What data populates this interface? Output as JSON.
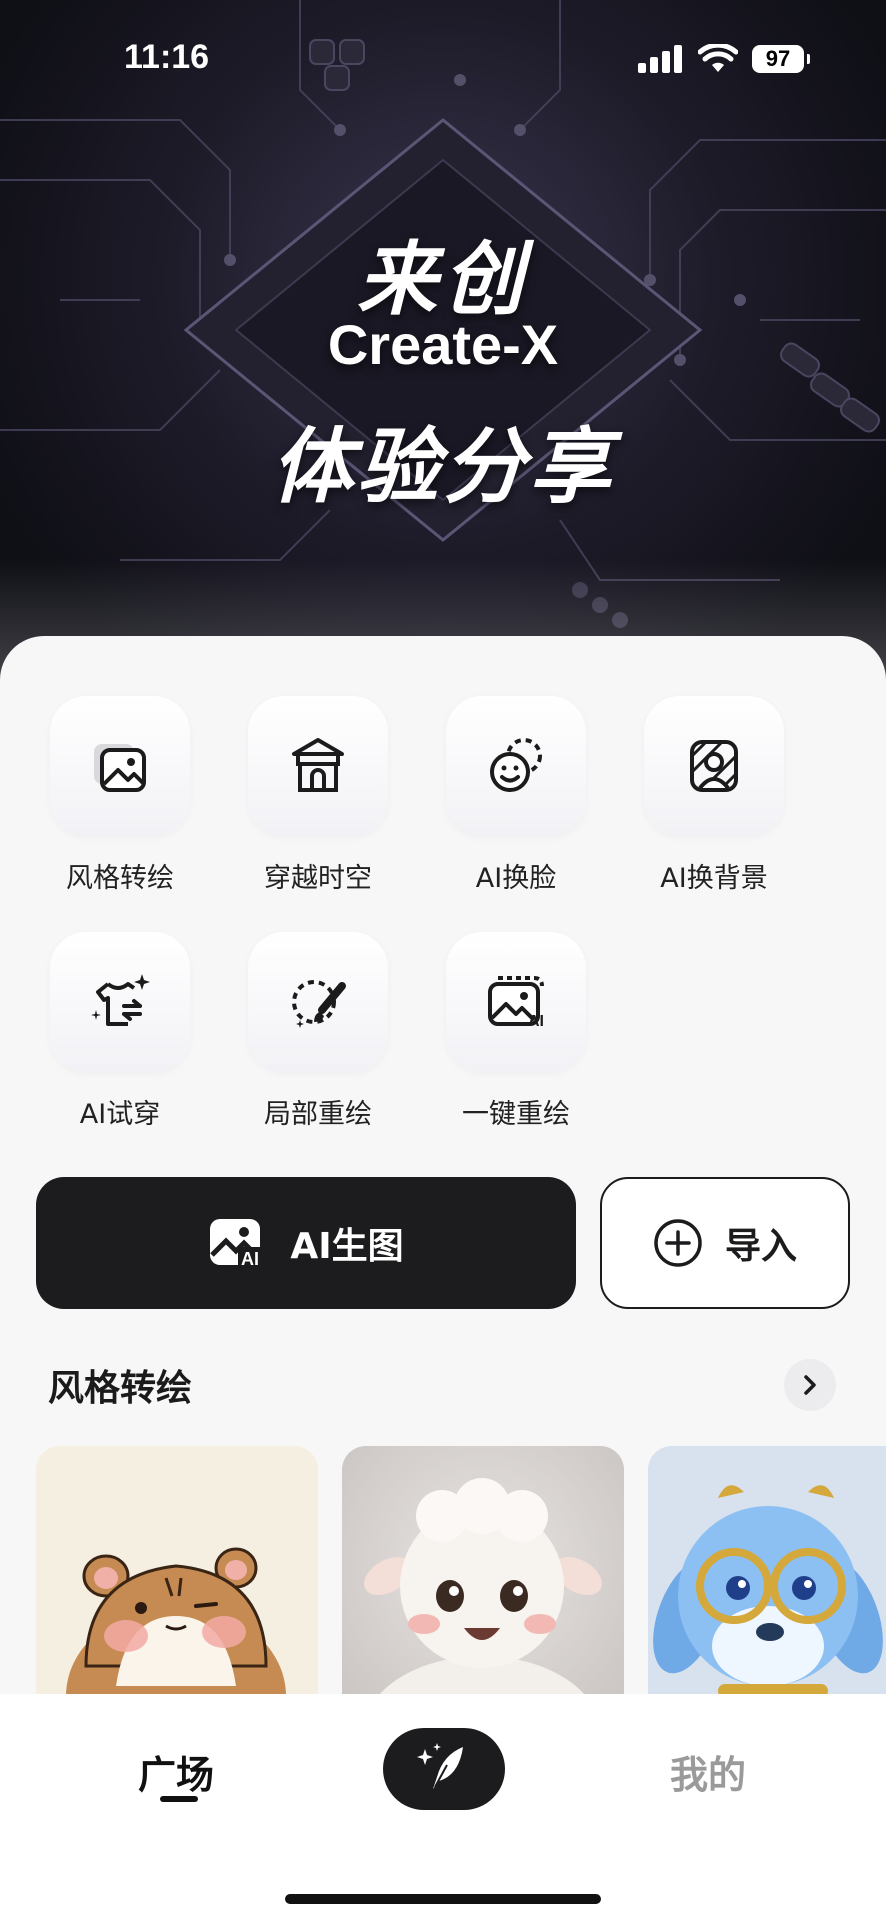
{
  "status_bar": {
    "time": "11:16",
    "battery": "97"
  },
  "hero": {
    "title_cn": "来创",
    "title_en": "Create-X",
    "subtitle": "体验分享"
  },
  "features": [
    {
      "label": "风格转绘",
      "icon": "image-stack-icon"
    },
    {
      "label": "穿越时空",
      "icon": "pavilion-icon"
    },
    {
      "label": "AI换脸",
      "icon": "face-swap-icon"
    },
    {
      "label": "AI换背景",
      "icon": "portrait-background-icon"
    },
    {
      "label": "AI试穿",
      "icon": "tshirt-sparkle-icon"
    },
    {
      "label": "局部重绘",
      "icon": "brush-selection-icon"
    },
    {
      "label": "一键重绘",
      "icon": "image-ai-icon"
    }
  ],
  "actions": {
    "ai_generate": "AI生图",
    "import": "导入"
  },
  "section": {
    "title": "风格转绘"
  },
  "cards": [
    {
      "subject": "hamster-illustration",
      "bg": "#f5efe2"
    },
    {
      "subject": "lamb-3d-render",
      "bg": "#dcd8d6"
    },
    {
      "subject": "puppy-glasses-render",
      "bg": "#d8e2ee"
    }
  ],
  "tabbar": {
    "home": "广场",
    "mine": "我的"
  },
  "colors": {
    "primary_dark": "#1c1c1e",
    "sheet_bg": "#f7f7f8",
    "inactive_tab": "#9a9a9a"
  }
}
